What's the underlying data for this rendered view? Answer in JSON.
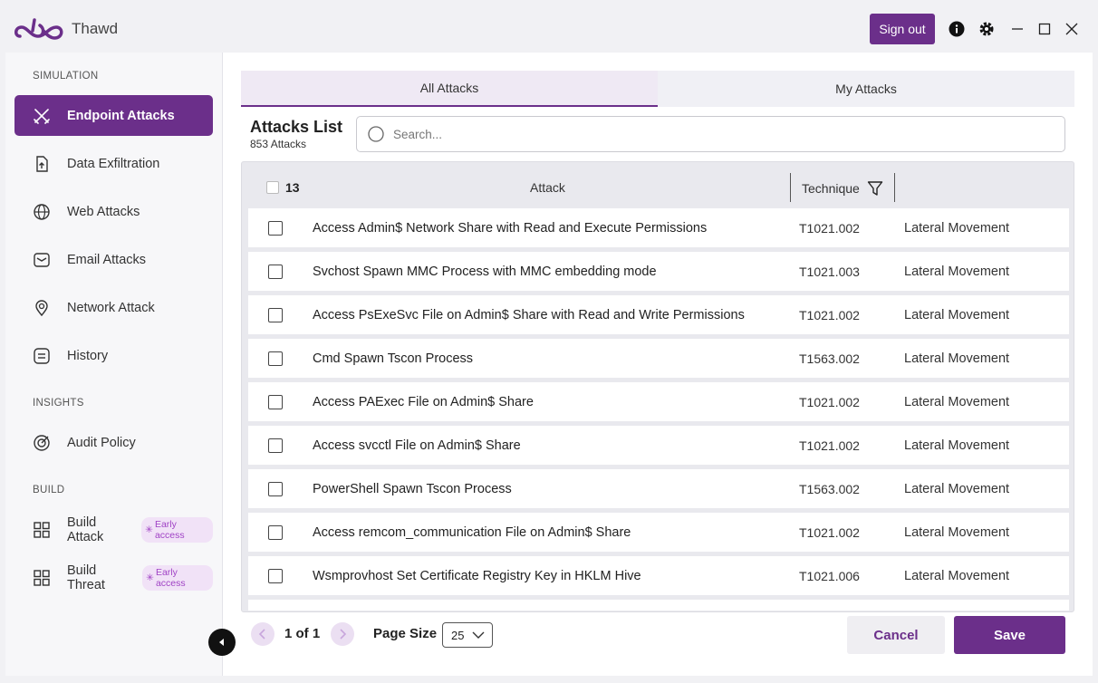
{
  "app": {
    "name": "Thawd"
  },
  "titlebar": {
    "sign_out_label": "Sign out",
    "icons": [
      "info-icon",
      "gear-icon",
      "minimize-icon",
      "maximize-icon",
      "close-icon"
    ]
  },
  "sidebar": {
    "sections": {
      "simulation": "SIMULATION",
      "insights": "INSIGHTS",
      "build": "BUILD"
    },
    "items": [
      {
        "label": "Endpoint Attacks",
        "icon": "swords-icon",
        "active": true
      },
      {
        "label": "Data Exfiltration",
        "icon": "upload-file-icon"
      },
      {
        "label": "Web Attacks",
        "icon": "globe-icon"
      },
      {
        "label": "Email Attacks",
        "icon": "mail-icon"
      },
      {
        "label": "Network Attack",
        "icon": "network-pin-icon"
      },
      {
        "label": "History",
        "icon": "history-icon"
      },
      {
        "label": "Audit Policy",
        "icon": "target-icon"
      },
      {
        "label": "Build Attack",
        "icon": "grid-icon",
        "badge": "Early access"
      },
      {
        "label": "Build Threat",
        "icon": "grid-icon",
        "badge": "Early access"
      }
    ]
  },
  "tabs": [
    {
      "label": "All Attacks",
      "active": true
    },
    {
      "label": "My Attacks",
      "active": false
    }
  ],
  "list": {
    "title": "Attacks List",
    "count": "853 Attacks",
    "search_placeholder": "Search..."
  },
  "table": {
    "selected_count": "13",
    "headers": {
      "attack": "Attack",
      "technique": "Technique"
    },
    "rows": [
      {
        "name": "Access Admin$ Network Share with Read and Execute Permissions",
        "technique": "T1021.002",
        "tactic": "Lateral Movement"
      },
      {
        "name": "Svchost Spawn MMC Process with MMC embedding mode",
        "technique": "T1021.003",
        "tactic": "Lateral Movement"
      },
      {
        "name": "Access PsExeSvc File on Admin$ Share with Read and Write Permissions",
        "technique": "T1021.002",
        "tactic": "Lateral Movement"
      },
      {
        "name": "Cmd Spawn Tscon Process",
        "technique": "T1563.002",
        "tactic": "Lateral Movement"
      },
      {
        "name": "Access PAExec File on Admin$ Share",
        "technique": "T1021.002",
        "tactic": "Lateral Movement"
      },
      {
        "name": "Access svcctl File on Admin$ Share",
        "technique": "T1021.002",
        "tactic": "Lateral Movement"
      },
      {
        "name": "PowerShell Spawn Tscon Process",
        "technique": "T1563.002",
        "tactic": "Lateral Movement"
      },
      {
        "name": "Access remcom_communication File on Admin$ Share",
        "technique": "T1021.002",
        "tactic": "Lateral Movement"
      },
      {
        "name": "Wsmprovhost Set Certificate Registry Key in HKLM Hive",
        "technique": "T1021.006",
        "tactic": "Lateral Movement"
      }
    ]
  },
  "pagination": {
    "label": "1 of 1",
    "page_size_label": "Page Size",
    "page_size_value": "25"
  },
  "footer": {
    "cancel_label": "Cancel",
    "save_label": "Save"
  },
  "colors": {
    "accent": "#6b2f8a",
    "badge": "#a043c5"
  }
}
